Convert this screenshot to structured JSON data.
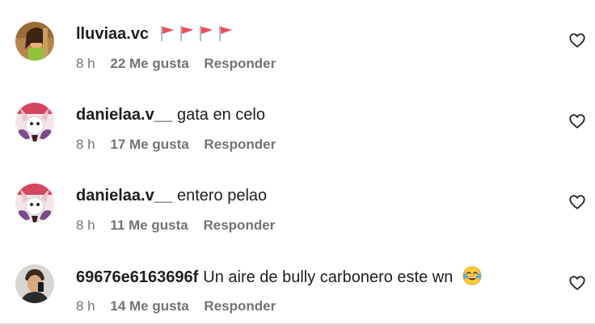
{
  "comments": [
    {
      "username": "lluviaa.vc",
      "text": "",
      "time": "8 h",
      "likes": "22 Me gusta",
      "reply": "Responder",
      "decoration": "red-flag-emoji x4"
    },
    {
      "username": "danielaa.v__",
      "text": "gata en celo",
      "time": "8 h",
      "likes": "17 Me gusta",
      "reply": "Responder"
    },
    {
      "username": "danielaa.v__",
      "text": "entero pelao",
      "time": "8 h",
      "likes": "11 Me gusta",
      "reply": "Responder"
    },
    {
      "username": "69676e6163696f",
      "text": "Un aire de bully carbonero este wn",
      "time": "8 h",
      "likes": "14 Me gusta",
      "reply": "Responder",
      "decoration": "laughing-crying-emoji"
    }
  ],
  "icons": {
    "like": "heart-outline-icon",
    "flag": "red-flag-icon",
    "laugh": "face-with-tears-of-joy-icon"
  },
  "colors": {
    "meta_text": "#737373",
    "flag": "#f04a5b"
  }
}
